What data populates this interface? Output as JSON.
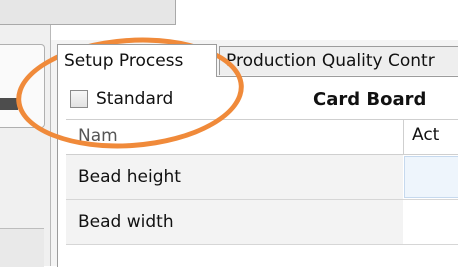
{
  "tabs": [
    {
      "label": "Setup Process"
    },
    {
      "label": "Production Quality Contr"
    }
  ],
  "settings": {
    "checkbox_label": "Standard",
    "checkbox_checked": false,
    "material_title": "Card Board"
  },
  "grid": {
    "columns": [
      "Nam",
      "Act"
    ],
    "rows": [
      {
        "name": "Bead height",
        "value": ""
      },
      {
        "name": "Bead width",
        "value": ""
      }
    ]
  },
  "annotation": {
    "color": "#f08a3a"
  }
}
